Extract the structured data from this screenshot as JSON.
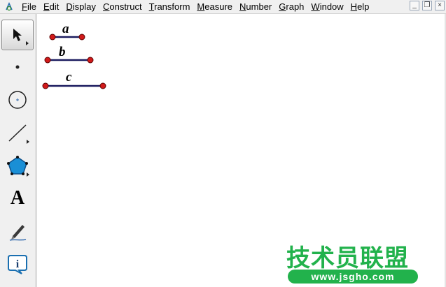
{
  "menubar": {
    "app_icon": "sketchpad-app-icon",
    "items": [
      {
        "label": "File"
      },
      {
        "label": "Edit"
      },
      {
        "label": "Display"
      },
      {
        "label": "Construct"
      },
      {
        "label": "Transform"
      },
      {
        "label": "Measure"
      },
      {
        "label": "Number"
      },
      {
        "label": "Graph"
      },
      {
        "label": "Window"
      },
      {
        "label": "Help"
      }
    ],
    "window_buttons": {
      "minimize": "_",
      "restore": "❐",
      "close": "×"
    }
  },
  "toolbox": {
    "tools": [
      {
        "name": "arrow-select-tool",
        "icon": "arrow-cursor-icon",
        "selected": true
      },
      {
        "name": "point-tool",
        "icon": "point-icon"
      },
      {
        "name": "compass-tool",
        "icon": "circle-icon"
      },
      {
        "name": "straightedge-tool",
        "icon": "segment-icon"
      },
      {
        "name": "polygon-tool",
        "icon": "pentagon-icon"
      },
      {
        "name": "text-tool",
        "icon": "text-A-icon",
        "label": "A"
      },
      {
        "name": "marker-tool",
        "icon": "pen-icon"
      },
      {
        "name": "information-tool",
        "icon": "info-icon"
      }
    ]
  },
  "canvas": {
    "segments": [
      {
        "label": "a"
      },
      {
        "label": "b"
      },
      {
        "label": "c"
      }
    ],
    "colors": {
      "segment": "#1a1a5e",
      "endpoint": "#d11a1a",
      "endpoint_stroke": "#5a0000"
    }
  },
  "watermark": {
    "title": "技术员联盟",
    "url": "www.jsgho.com",
    "color": "#22b24c"
  }
}
